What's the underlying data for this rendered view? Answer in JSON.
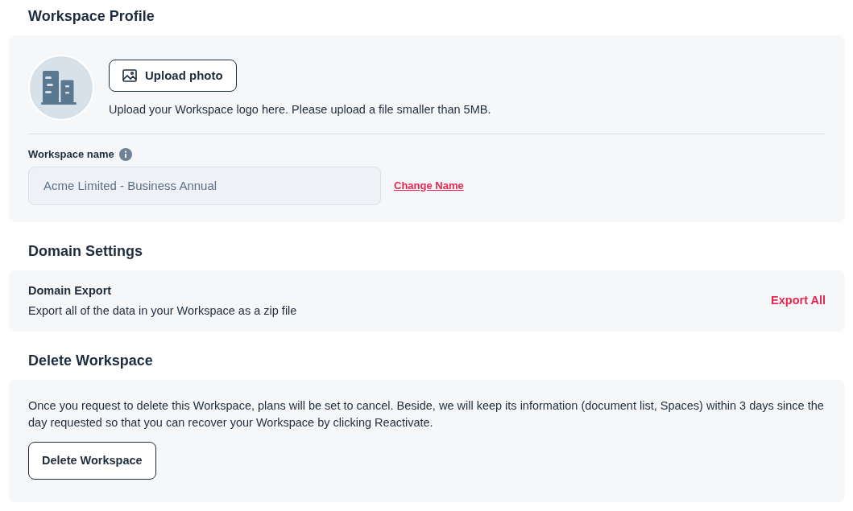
{
  "profile": {
    "heading": "Workspace Profile",
    "upload_button": "Upload photo",
    "upload_hint": "Upload your Workspace logo here. Please upload a file smaller than 5MB.",
    "name_label": "Workspace name",
    "name_field": {
      "value": "Acme Limited - Business Annual",
      "disabled": true
    },
    "change_link": "Change Name"
  },
  "domain": {
    "heading": "Domain Settings",
    "title": "Domain Export",
    "description": "Export all of the data in your Workspace as a zip file",
    "action": "Export All"
  },
  "delete": {
    "heading": "Delete Workspace",
    "description": "Once you request to delete this Workspace, plans will be set to cancel. Beside, we will keep its information (document list, Spaces) within 3 days since the day requested so that you can recover your Workspace by clicking Reactivate.",
    "button": "Delete Workspace"
  }
}
